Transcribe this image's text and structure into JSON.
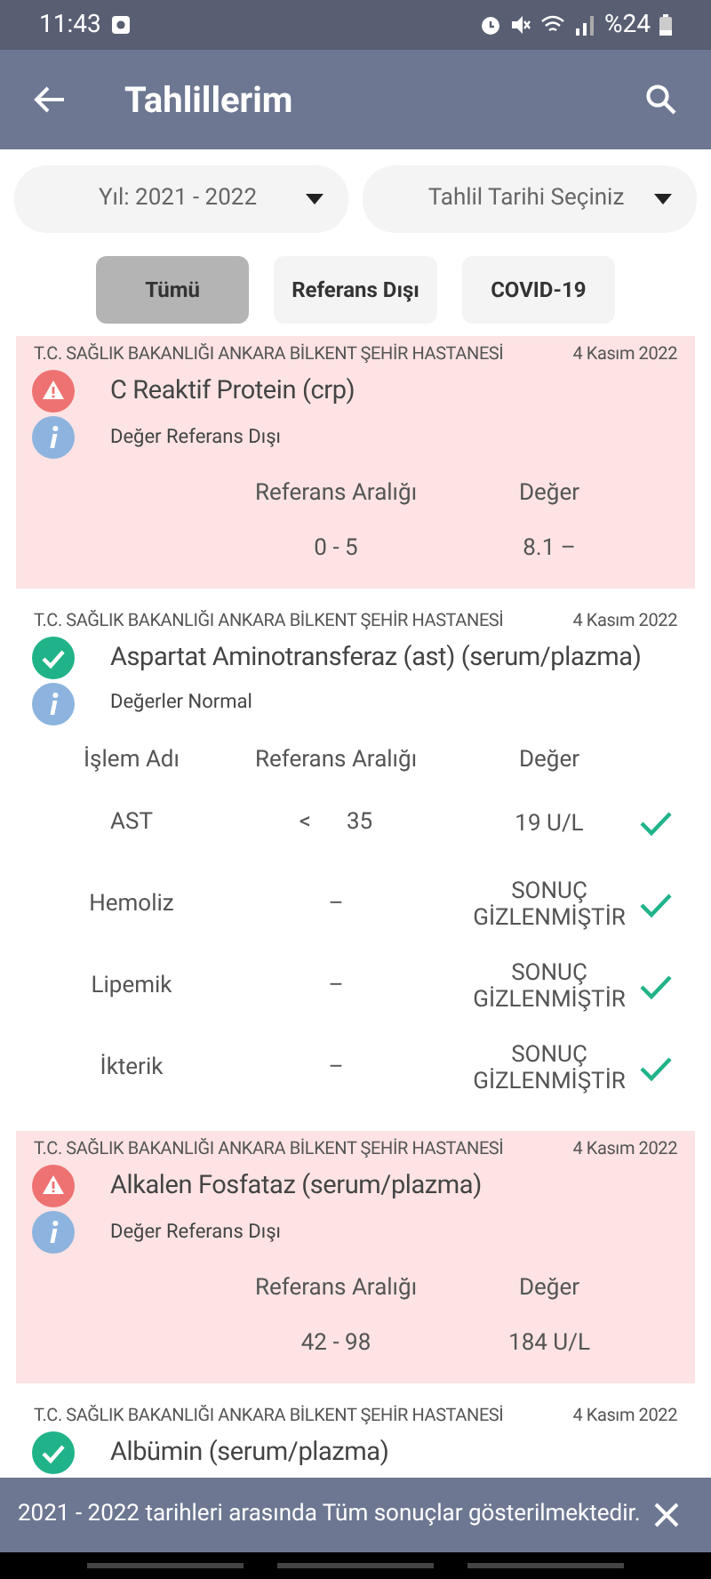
{
  "status_bar": {
    "time": "11:43",
    "battery": "%24"
  },
  "app_bar": {
    "title": "Tahlillerim"
  },
  "filters": [
    {
      "label": "Yıl: 2021 - 2022"
    },
    {
      "label": "Tahlil Tarihi Seçiniz"
    }
  ],
  "tabs": [
    {
      "label": "Tümü",
      "selected": true
    },
    {
      "label": "Referans Dışı",
      "selected": false
    },
    {
      "label": "COVID-19",
      "selected": false
    }
  ],
  "results": [
    {
      "kind": "abnormal",
      "hospital": "T.C. SAĞLIK BAKANLIĞI ANKARA BİLKENT ŞEHİR HASTANESİ",
      "date": "4 Kasım 2022",
      "title": "C Reaktif Protein (crp)",
      "note": "Değer Referans Dışı",
      "columns": [
        "Referans Aralığı",
        "Değer"
      ],
      "rows": [
        {
          "range": "0 - 5",
          "value": "8.1 –"
        }
      ]
    },
    {
      "kind": "normal",
      "hospital": "T.C. SAĞLIK BAKANLIĞI ANKARA BİLKENT ŞEHİR HASTANESİ",
      "date": "4 Kasım 2022",
      "title": "Aspartat Aminotransferaz (ast) (serum/plazma)",
      "note": "Değerler Normal",
      "columns": [
        "İşlem Adı",
        "Referans Aralığı",
        "Değer"
      ],
      "rows": [
        {
          "name": "AST",
          "operator": "<",
          "range": "35",
          "value": "19 U/L",
          "ok": true
        },
        {
          "name": "Hemoliz",
          "range": "–",
          "value": "SONUÇ GİZLENMİŞTİR",
          "ok": true
        },
        {
          "name": "Lipemik",
          "range": "–",
          "value": "SONUÇ GİZLENMİŞTİR",
          "ok": true
        },
        {
          "name": "İkterik",
          "range": "–",
          "value": "SONUÇ GİZLENMİŞTİR",
          "ok": true
        }
      ]
    },
    {
      "kind": "abnormal",
      "hospital": "T.C. SAĞLIK BAKANLIĞI ANKARA BİLKENT ŞEHİR HASTANESİ",
      "date": "4 Kasım 2022",
      "title": "Alkalen Fosfataz (serum/plazma)",
      "note": "Değer Referans Dışı",
      "columns": [
        "Referans Aralığı",
        "Değer"
      ],
      "rows": [
        {
          "range": "42 - 98",
          "value": "184 U/L"
        }
      ]
    },
    {
      "kind": "normal",
      "hospital": "T.C. SAĞLIK BAKANLIĞI ANKARA BİLKENT ŞEHİR HASTANESİ",
      "date": "4 Kasım 2022",
      "title": "Albümin (serum/plazma)"
    }
  ],
  "snackbar": {
    "message": "2021 - 2022 tarihleri arasında Tüm sonuçlar gösterilmektedir."
  }
}
